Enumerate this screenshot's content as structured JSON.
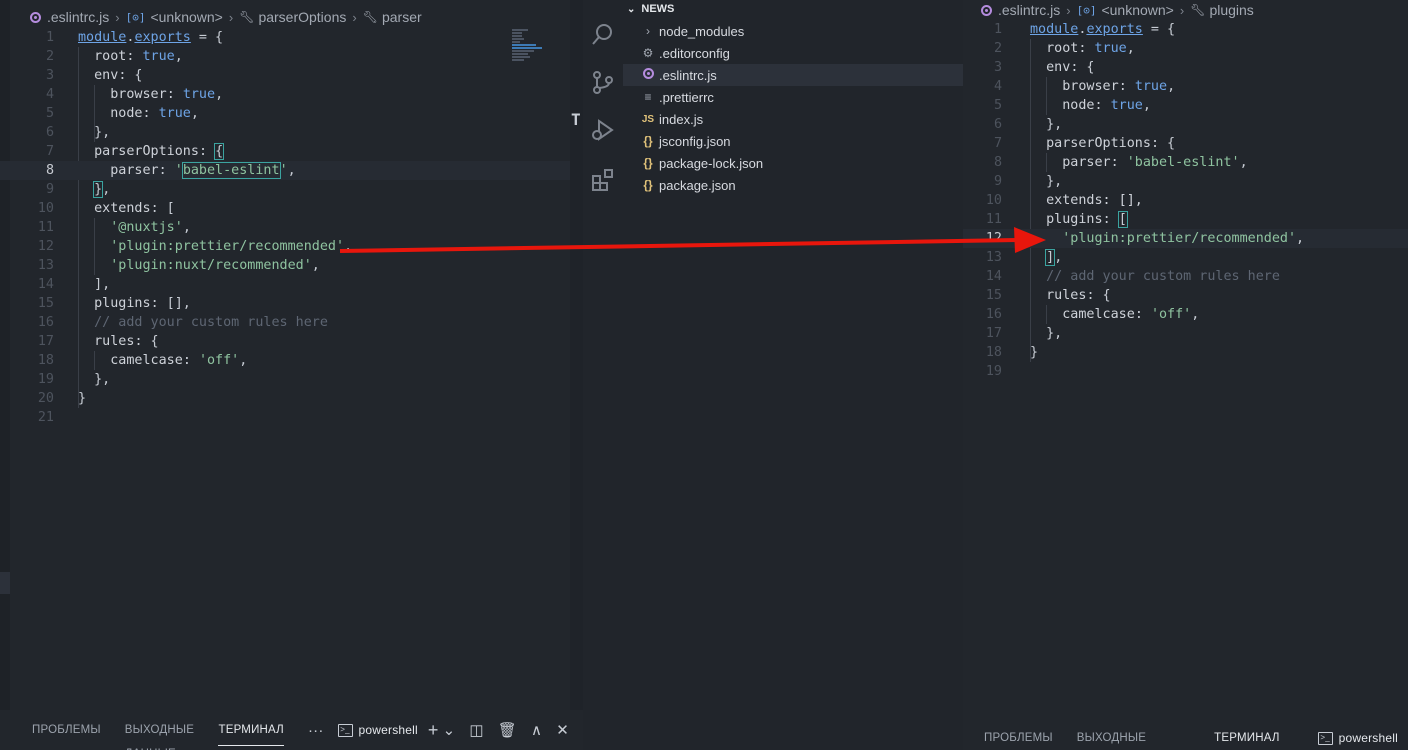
{
  "left_breadcrumb": {
    "file": ".eslintrc.js",
    "symbol1": "<unknown>",
    "symbol2": "parserOptions",
    "symbol3": "parser",
    "icon_file": "eslint-icon",
    "icon_symbol1": "variable-cube-icon",
    "icon_symbol2": "wrench-icon",
    "icon_symbol3": "wrench-icon"
  },
  "left_lines": [
    {
      "n": "1"
    },
    {
      "n": "2"
    },
    {
      "n": "3"
    },
    {
      "n": "4"
    },
    {
      "n": "5"
    },
    {
      "n": "6"
    },
    {
      "n": "7"
    },
    {
      "n": "8"
    },
    {
      "n": "9"
    },
    {
      "n": "10"
    },
    {
      "n": "11"
    },
    {
      "n": "12"
    },
    {
      "n": "13"
    },
    {
      "n": "14"
    },
    {
      "n": "15"
    },
    {
      "n": "16"
    },
    {
      "n": "17"
    },
    {
      "n": "18"
    },
    {
      "n": "19"
    },
    {
      "n": "20"
    },
    {
      "n": "21"
    }
  ],
  "left_code": {
    "l1a": "module",
    "l1b": ".",
    "l1c": "exports",
    "l1d": " = {",
    "l2a": "  root",
    "l2b": ": ",
    "l2c": "true",
    "l2d": ",",
    "l3a": "  env",
    "l3b": ": {",
    "l4a": "    browser",
    "l4b": ": ",
    "l4c": "true",
    "l4d": ",",
    "l5a": "    node",
    "l5b": ": ",
    "l5c": "true",
    "l5d": ",",
    "l6": "  },",
    "l7a": "  parserOptions",
    "l7b": ": ",
    "l7c": "{",
    "l8a": "    parser",
    "l8b": ": ",
    "l8c": "'",
    "l8d": "babel-eslint",
    "l8e": "'",
    "l8f": ",",
    "l9a": "  ",
    "l9b": "}",
    "l9c": ",",
    "l10a": "  extends",
    "l10b": ": [",
    "l11a": "    ",
    "l11b": "'@nuxtjs'",
    "l11c": ",",
    "l12a": "    ",
    "l12b": "'plugin:prettier/recommended'",
    "l12c": ",",
    "l13a": "    ",
    "l13b": "'plugin:nuxt/recommended'",
    "l13c": ",",
    "l14": "  ],",
    "l15a": "  plugins",
    "l15b": ": [],",
    "l16": "  // add your custom rules here",
    "l17a": "  rules",
    "l17b": ": {",
    "l18a": "    camelcase",
    "l18b": ": ",
    "l18c": "'off'",
    "l18d": ",",
    "l19": "  },",
    "l20": "}",
    "l21": ""
  },
  "right_breadcrumb": {
    "file": ".eslintrc.js",
    "symbol1": "<unknown>",
    "symbol2": "plugins"
  },
  "right_lines": [
    {
      "n": "1"
    },
    {
      "n": "2"
    },
    {
      "n": "3"
    },
    {
      "n": "4"
    },
    {
      "n": "5"
    },
    {
      "n": "6"
    },
    {
      "n": "7"
    },
    {
      "n": "8"
    },
    {
      "n": "9"
    },
    {
      "n": "10"
    },
    {
      "n": "11"
    },
    {
      "n": "12"
    },
    {
      "n": "13"
    },
    {
      "n": "14"
    },
    {
      "n": "15"
    },
    {
      "n": "16"
    },
    {
      "n": "17"
    },
    {
      "n": "18"
    },
    {
      "n": "19"
    }
  ],
  "right_code": {
    "l1a": "module",
    "l1b": ".",
    "l1c": "exports",
    "l1d": " = {",
    "l2a": "  root",
    "l2b": ": ",
    "l2c": "true",
    "l2d": ",",
    "l3a": "  env",
    "l3b": ": {",
    "l4a": "    browser",
    "l4b": ": ",
    "l4c": "true",
    "l4d": ",",
    "l5a": "    node",
    "l5b": ": ",
    "l5c": "true",
    "l5d": ",",
    "l6": "  },",
    "l7a": "  parserOptions",
    "l7b": ": {",
    "l8a": "    parser",
    "l8b": ": ",
    "l8c": "'babel-eslint'",
    "l8d": ",",
    "l9": "  },",
    "l10": "  extends: [],",
    "l11a": "  plugins",
    "l11b": ": ",
    "l11c": "[",
    "l12a": "    ",
    "l12b": "'plugin:prettier/recommended'",
    "l12c": ",",
    "l13a": "  ",
    "l13b": "]",
    "l13c": ",",
    "l14": "  // add your custom rules here",
    "l15a": "  rules",
    "l15b": ": {",
    "l16a": "    camelcase",
    "l16b": ": ",
    "l16c": "'off'",
    "l16d": ",",
    "l17": "  },",
    "l18": "}",
    "l19": ""
  },
  "explorer": {
    "title": "NEWS",
    "items": [
      {
        "label": "node_modules",
        "icon": "chevron-right-icon"
      },
      {
        "label": ".editorconfig",
        "icon": "gear-icon"
      },
      {
        "label": ".eslintrc.js",
        "icon": "eslint-icon"
      },
      {
        "label": ".prettierrc",
        "icon": "lines-icon"
      },
      {
        "label": "index.js",
        "icon": "js-icon",
        "glyph": "JS"
      },
      {
        "label": "jsconfig.json",
        "icon": "json-icon",
        "glyph": "{}"
      },
      {
        "label": "package-lock.json",
        "icon": "json-icon",
        "glyph": "{}"
      },
      {
        "label": "package.json",
        "icon": "json-icon",
        "glyph": "{}"
      }
    ]
  },
  "panel_left": {
    "tab1": "ПРОБЛЕМЫ",
    "tab2": "ВЫХОДНЫЕ ДАННЫЕ",
    "tab3": "ТЕРМИНАЛ",
    "more": "···",
    "shell": "powershell",
    "shell_glyph": ">_",
    "plus": "+",
    "chevron": "⌄",
    "split": "◫",
    "trash": "🗑",
    "up": "∧",
    "close": "✕"
  },
  "panel_right": {
    "tab1": "ПРОБЛЕМЫ",
    "tab2": "ВЫХОДНЫЕ ДАННЫЕ",
    "tab3": "ТЕРМИНАЛ",
    "shell": "powershell",
    "shell_glyph": ">_"
  },
  "colors": {
    "arrow": "#e8160c",
    "accent_bracket": "#3ba3a0",
    "string": "#8fc3a0",
    "keyword": "#6ea4e6"
  }
}
